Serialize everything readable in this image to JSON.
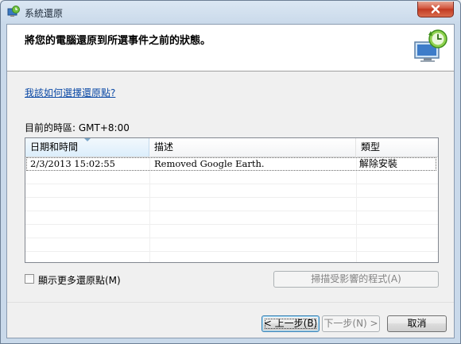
{
  "window": {
    "title": "系統還原",
    "close_label": "×"
  },
  "header": {
    "title": "將您的電腦還原到所選事件之前的狀態。",
    "icon": "system-restore-icon"
  },
  "help_link": "我該如何選擇還原點?",
  "timezone": "目前的時區: GMT+8:00",
  "list": {
    "columns": [
      "日期和時間",
      "描述",
      "類型"
    ],
    "rows": [
      {
        "datetime": "2/3/2013 15:02:55",
        "description": "Removed Google Earth.",
        "type": "解除安裝"
      }
    ]
  },
  "show_more": {
    "label": "顯示更多還原點(M)",
    "checked": false
  },
  "buttons": {
    "scan": "掃描受影響的程式(A)",
    "back": "< 上一步(B)",
    "next": "下一步(N) >",
    "cancel": "取消"
  },
  "colors": {
    "link": "#0c4aa6",
    "close": "#c13a22",
    "selection_border": "#6a6a6a"
  }
}
